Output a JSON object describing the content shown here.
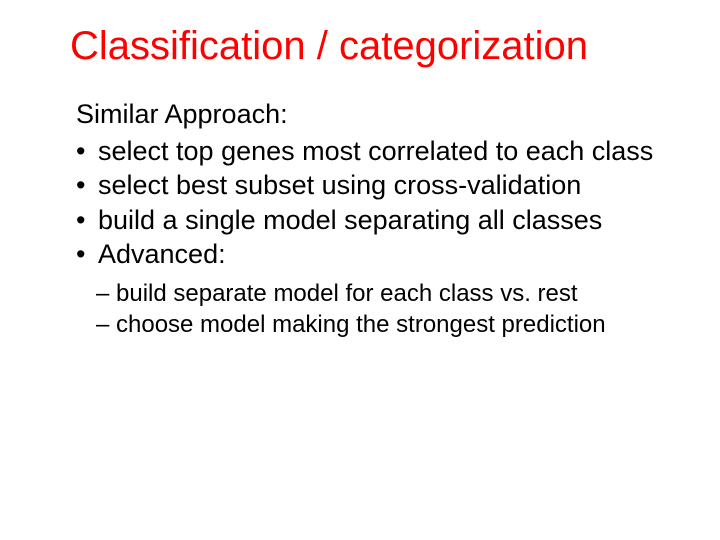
{
  "slide": {
    "title": "Classification / categorization",
    "lead": "Similar Approach:",
    "bullets": [
      "select top genes most correlated to each class",
      "select best subset using cross-validation",
      "build a single model separating all classes",
      "Advanced:"
    ],
    "sub_bullets": [
      "build separate model for each class vs. rest",
      "choose model making the strongest prediction"
    ]
  }
}
